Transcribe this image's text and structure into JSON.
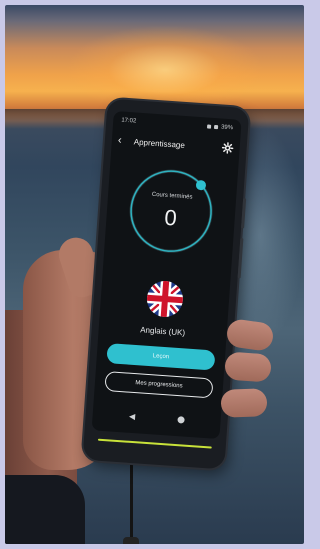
{
  "status_bar": {
    "time": "17:02",
    "battery": "39%"
  },
  "app": {
    "title": "Apprentissage",
    "ring_label": "Cours terminés",
    "ring_value": "0",
    "language": "Anglais (UK)",
    "primary_button": "Leçon",
    "secondary_button": "Mes progressions"
  },
  "colors": {
    "accent": "#2fc0cf",
    "device_strip": "#c8e23a"
  },
  "icons": {
    "back": "back-arrow-icon",
    "settings": "gear-icon",
    "flag": "uk-flag-icon",
    "nav_back": "triangle-back-icon",
    "nav_home": "circle-home-icon"
  }
}
